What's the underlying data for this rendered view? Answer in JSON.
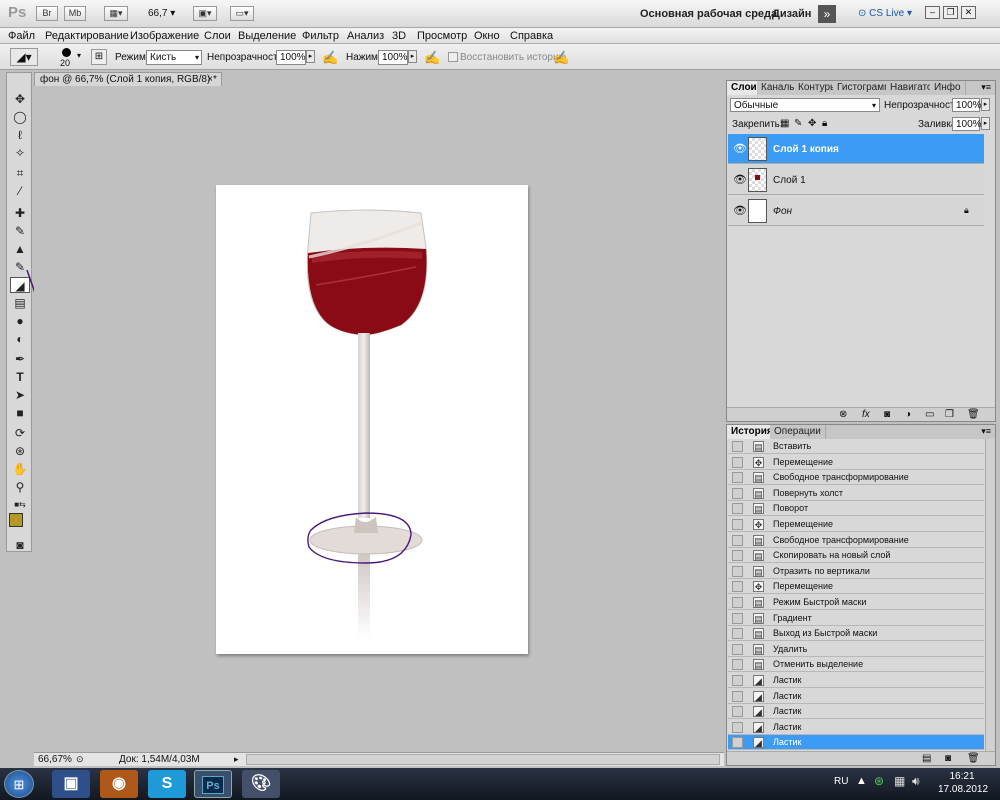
{
  "appbar": {
    "logo": "Ps",
    "br": "Br",
    "mb": "Mb",
    "zoom": "66,7",
    "workspace": "Основная рабочая среда",
    "design": "Дизайн",
    "cslive": "CS Live"
  },
  "menu": [
    "Файл",
    "Редактирование",
    "Изображение",
    "Слои",
    "Выделение",
    "Фильтр",
    "Анализ",
    "3D",
    "Просмотр",
    "Окно",
    "Справка"
  ],
  "options": {
    "brush_size": "20",
    "mode_label": "Режим:",
    "mode_value": "Кисть",
    "opacity_label": "Непрозрачность:",
    "opacity_value": "100%",
    "press_label": "Нажим:",
    "press_value": "100%",
    "restore_label": "Восстановить историю"
  },
  "document": {
    "tab_title": "фон @ 66,7% (Слой 1 копия, RGB/8) *",
    "close": "×",
    "zoom": "66,67%",
    "doc_info": "Док: 1,54M/4,03M"
  },
  "layers_panel": {
    "tabs": [
      "Слои",
      "Каналы",
      "Контуры",
      "Гистограмма",
      "Навигатор",
      "Инфо"
    ],
    "blend_mode": "Обычные",
    "opacity_label": "Непрозрачность:",
    "opacity_value": "100%",
    "lock_label": "Закрепить:",
    "fill_label": "Заливка:",
    "fill_value": "100%",
    "layers": [
      {
        "name": "Слой 1 копия",
        "selected": true
      },
      {
        "name": "Слой 1",
        "selected": false
      },
      {
        "name": "Фон",
        "selected": false
      }
    ]
  },
  "history_panel": {
    "tabs": [
      "История",
      "Операции"
    ],
    "items": [
      "Вставить",
      "Перемещение",
      "Свободное трансформирование",
      "Повернуть холст",
      "Поворот",
      "Перемещение",
      "Свободное трансформирование",
      "Скопировать на новый слой",
      "Отразить по вертикали",
      "Перемещение",
      "Режим Быстрой маски",
      "Градиент",
      "Выход из Быстрой маски",
      "Удалить",
      "Отменить выделение",
      "Ластик",
      "Ластик",
      "Ластик",
      "Ластик",
      "Ластик"
    ]
  },
  "taskbar": {
    "lang": "RU",
    "time": "16:21",
    "date": "17.08.2012"
  },
  "colors": {
    "selection": "#3c9bf4",
    "wine": "#8a0a16",
    "annotation": "#4a1a7a"
  },
  "icons": [
    "move-icon",
    "lasso-icon",
    "crop-icon",
    "eraser-icon",
    "brush-icon",
    "eye-icon",
    "lock-icon",
    "trash-icon"
  ]
}
